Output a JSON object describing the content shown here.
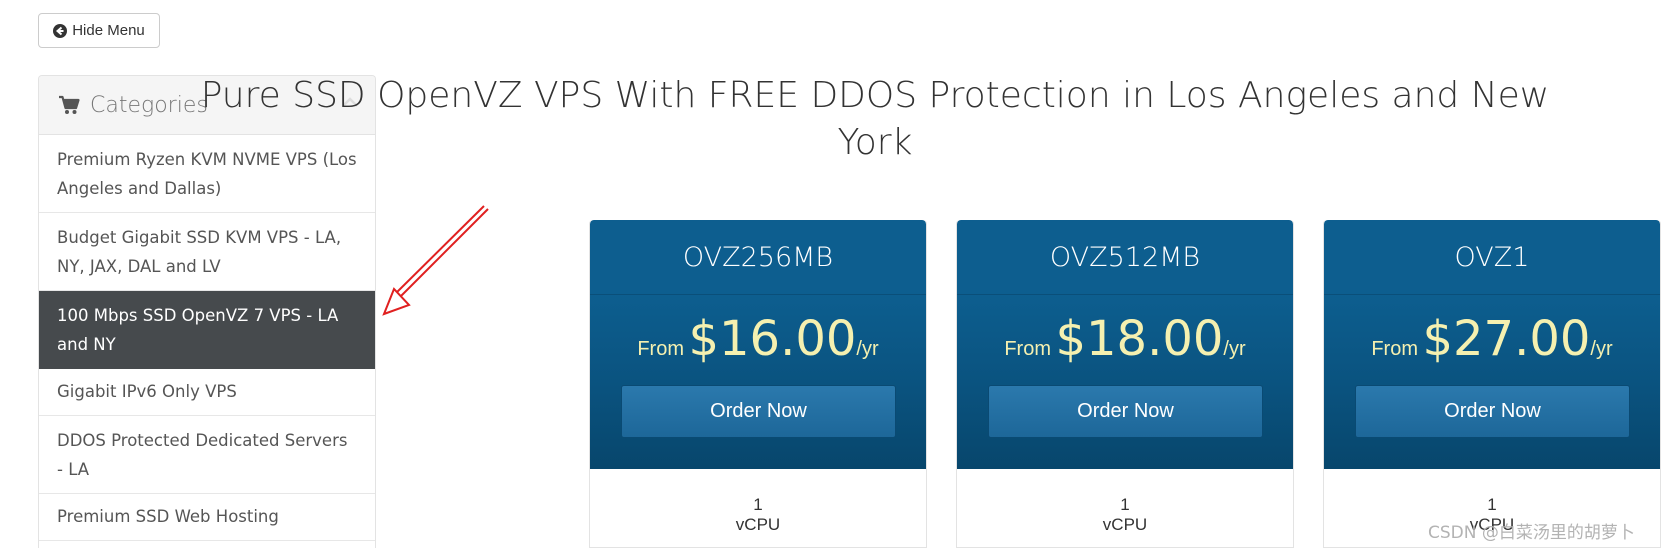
{
  "toolbar": {
    "hide_menu_label": "Hide Menu"
  },
  "sidebar": {
    "title": "Categories",
    "items": [
      {
        "label": "Premium Ryzen KVM NVME VPS (Los Angeles and Dallas)"
      },
      {
        "label": "Budget Gigabit SSD KVM VPS - LA, NY, JAX, DAL and LV"
      },
      {
        "label": "100 Mbps SSD OpenVZ 7 VPS - LA and NY",
        "active": true
      },
      {
        "label": "Gigabit IPv6 Only VPS"
      },
      {
        "label": "DDOS Protected Dedicated Servers - LA"
      },
      {
        "label": "Premium SSD Web Hosting"
      }
    ]
  },
  "main": {
    "heading": "Pure SSD OpenVZ VPS With FREE DDOS Protection in Los Angeles and New York",
    "products": [
      {
        "name": "OVZ256MB",
        "from": "From",
        "price": "$16.00",
        "period": "/yr",
        "order_label": "Order Now",
        "cpu_count": "1",
        "cpu_unit": "vCPU"
      },
      {
        "name": "OVZ512MB",
        "from": "From",
        "price": "$18.00",
        "period": "/yr",
        "order_label": "Order Now",
        "cpu_count": "1",
        "cpu_unit": "vCPU"
      },
      {
        "name": "OVZ1",
        "from": "From",
        "price": "$27.00",
        "period": "/yr",
        "order_label": "Order Now",
        "cpu_count": "1",
        "cpu_unit": "vCPU"
      }
    ]
  },
  "watermark": "CSDN @白菜汤里的胡萝卜",
  "colors": {
    "card_header": "#0d5e8f",
    "price_text": "#f5f0b0",
    "active_category": "#464a4d",
    "annotation_arrow": "#e02020"
  },
  "icons": {
    "hide_menu": "arrow-circle-left-icon",
    "categories": "shopping-cart-icon",
    "collapse": "chevron-up-icon"
  }
}
